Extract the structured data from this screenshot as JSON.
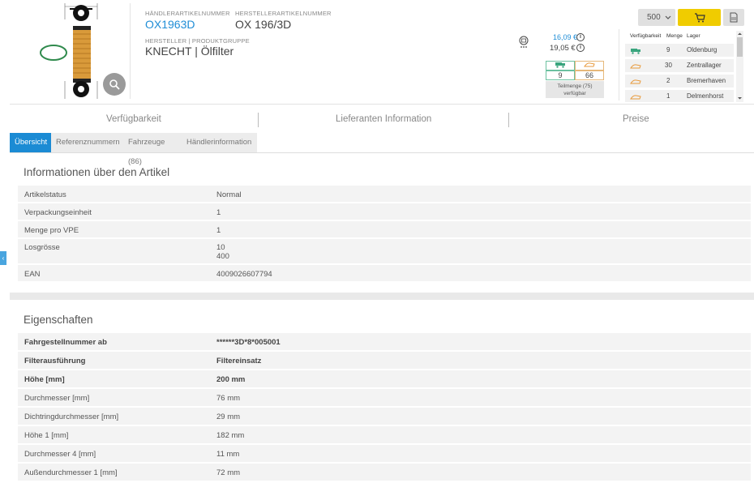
{
  "header": {
    "dealer_article_label": "HÄNDLERARTIKELNUMMER",
    "dealer_article_number": "OX1963D",
    "manufacturer_article_label": "HERSTELLERARTIKELNUMMER",
    "manufacturer_article_number": "OX 196/3D",
    "manufacturer_group_label": "HERSTELLER | PRODUKTGRUPPE",
    "manufacturer_group": "KNECHT | Ölfilter"
  },
  "pricing": {
    "price_net": "16,09 €",
    "price_gross": "19,05 €",
    "avail_left": "9",
    "avail_right": "66",
    "partial_line1": "Teilmenge (75)",
    "partial_line2": "verfügbar"
  },
  "order": {
    "quantity": "500"
  },
  "stock": {
    "headers": [
      "Verfügbarkeit",
      "Menge",
      "Lager"
    ],
    "rows": [
      {
        "status": "green",
        "qty": "9",
        "warehouse": "Oldenburg"
      },
      {
        "status": "orange",
        "qty": "30",
        "warehouse": "Zentrallager"
      },
      {
        "status": "orange",
        "qty": "2",
        "warehouse": "Bremerhaven"
      },
      {
        "status": "orange",
        "qty": "1",
        "warehouse": "Delmenhorst"
      }
    ]
  },
  "section_tabs": [
    "Verfügbarkeit",
    "Lieferanten Information",
    "Preise"
  ],
  "subtabs": [
    "Übersicht",
    "Referenznummern",
    "Fahrzeuge (86)",
    "Händlerinformation"
  ],
  "info": {
    "title": "Informationen über den Artikel",
    "rows": [
      {
        "key": "Artikelstatus",
        "value": "Normal"
      },
      {
        "key": "Verpackungseinheit",
        "value": "1"
      },
      {
        "key": "Menge pro VPE",
        "value": "1"
      },
      {
        "key": "Losgrösse",
        "value": "10",
        "value2": "400"
      },
      {
        "key": "EAN",
        "value": "4009026607794"
      }
    ]
  },
  "props": {
    "title": "Eigenschaften",
    "rows": [
      {
        "key": "Fahrgestellnummer ab",
        "value": "******3D*8*005001"
      },
      {
        "key": "Filterausführung",
        "value": "Filtereinsatz"
      },
      {
        "key": "Höhe [mm]",
        "value": "200 mm"
      },
      {
        "key": "Durchmesser [mm]",
        "value": "76 mm"
      },
      {
        "key": "Dichtringdurchmesser [mm]",
        "value": "29 mm"
      },
      {
        "key": "Höhe 1 [mm]",
        "value": "182 mm"
      },
      {
        "key": "Durchmesser 4 [mm]",
        "value": "11 mm"
      },
      {
        "key": "Außendurchmesser 1 [mm]",
        "value": "72 mm"
      }
    ]
  },
  "colors": {
    "accent_blue": "#1b8bd4",
    "cart_yellow": "#f0cc00",
    "stock_green": "#3aa57e",
    "stock_orange": "#e89a3c"
  },
  "icons": {
    "zoom": "magnifier-icon",
    "cart": "cart-icon",
    "doc": "document-icon",
    "info": "info-icon",
    "side": "chevron-left-icon"
  }
}
